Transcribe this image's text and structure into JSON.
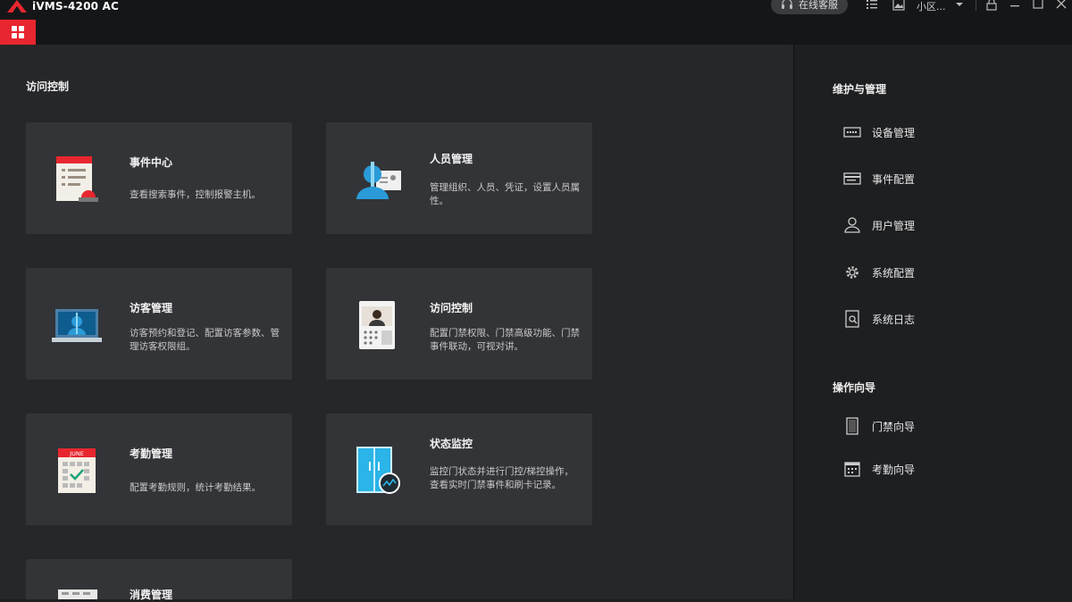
{
  "app": {
    "title": "iVMS-4200 AC"
  },
  "toolbar": {
    "online_support": "在线客服",
    "user": "小区..."
  },
  "main": {
    "section_title": "访问控制",
    "cards": [
      {
        "title": "事件中心",
        "desc": "查看搜索事件，控制报警主机。"
      },
      {
        "title": "人员管理",
        "desc": "管理组织、人员、凭证，设置人员属性。"
      },
      {
        "title": "访客管理",
        "desc": "访客预约和登记、配置访客参数、管理访客权限组。"
      },
      {
        "title": "访问控制",
        "desc": "配置门禁权限、门禁高级功能、门禁事件联动，可视对讲。"
      },
      {
        "title": "考勤管理",
        "desc": "配置考勤规则，统计考勤结果。"
      },
      {
        "title": "状态监控",
        "desc": "监控门状态并进行门控/梯控操作，查看实时门禁事件和刷卡记录。"
      },
      {
        "title": "消费管理",
        "desc": ""
      }
    ]
  },
  "right": {
    "maint_title": "维护与管理",
    "maint_items": [
      {
        "label": "设备管理",
        "icon": "device-icon"
      },
      {
        "label": "事件配置",
        "icon": "event-config-icon"
      },
      {
        "label": "用户管理",
        "icon": "user-icon"
      },
      {
        "label": "系统配置",
        "icon": "gear-icon"
      },
      {
        "label": "系统日志",
        "icon": "log-icon"
      }
    ],
    "guide_title": "操作向导",
    "guide_items": [
      {
        "label": "门禁向导",
        "icon": "door-icon"
      },
      {
        "label": "考勤向导",
        "icon": "calendar-icon"
      }
    ]
  },
  "calendar_month": "JUNE",
  "colors": {
    "accent": "#e8262f",
    "card_bg": "#333437",
    "panel_bg": "#1e1f21"
  }
}
